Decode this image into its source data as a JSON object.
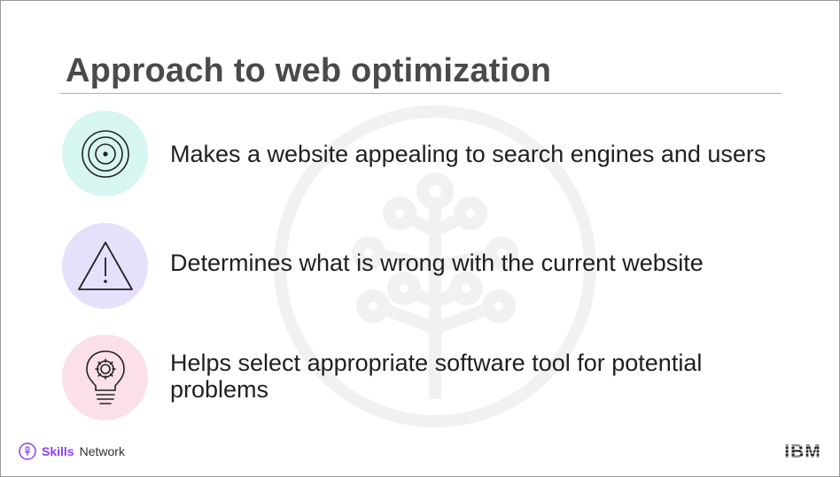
{
  "slide": {
    "title": "Approach to web optimization"
  },
  "items": [
    {
      "icon": "target-icon",
      "text": "Makes a website appealing to search engines and users",
      "circle_color": "#d8f6f1"
    },
    {
      "icon": "warning-icon",
      "text": "Determines what is wrong with the current website",
      "circle_color": "#e7e0fb"
    },
    {
      "icon": "lightbulb-gear-icon",
      "text": "Helps select appropriate software tool for potential problems",
      "circle_color": "#fbe1e7"
    }
  ],
  "footer": {
    "brand_strong": "Skills",
    "brand_rest": "Network",
    "logo": "IBM"
  },
  "colors": {
    "title": "#4a4a4a",
    "accent_purple": "#8a3ffc",
    "rule": "#aab0cf"
  }
}
